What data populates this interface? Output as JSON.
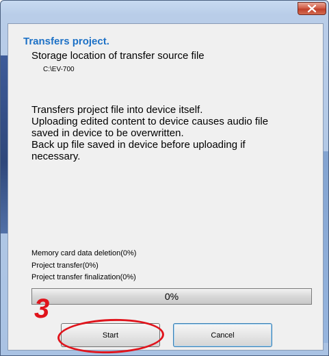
{
  "window": {
    "close_icon": "close-icon"
  },
  "dialog": {
    "title": "Transfers project.",
    "storage_label": "Storage location of transfer source file",
    "storage_path": "C:\\EV-700",
    "description_lines": [
      "Transfers project file into device itself.",
      "Uploading edited content to device causes audio file",
      "saved in device to be overwritten.",
      "Back up file saved in device before uploading if",
      "necessary."
    ]
  },
  "status": {
    "memory_card": "Memory card data deletion(0%)",
    "project_transfer": "Project transfer(0%)",
    "finalization": "Project transfer finalization(0%)"
  },
  "progress": {
    "value": 0,
    "label": "0%"
  },
  "buttons": {
    "start": "Start",
    "cancel": "Cancel"
  },
  "annotation": {
    "step": "3",
    "color": "#e0141c"
  },
  "colors": {
    "title": "#1d71c6",
    "accent_border": "#3c7fb1"
  }
}
